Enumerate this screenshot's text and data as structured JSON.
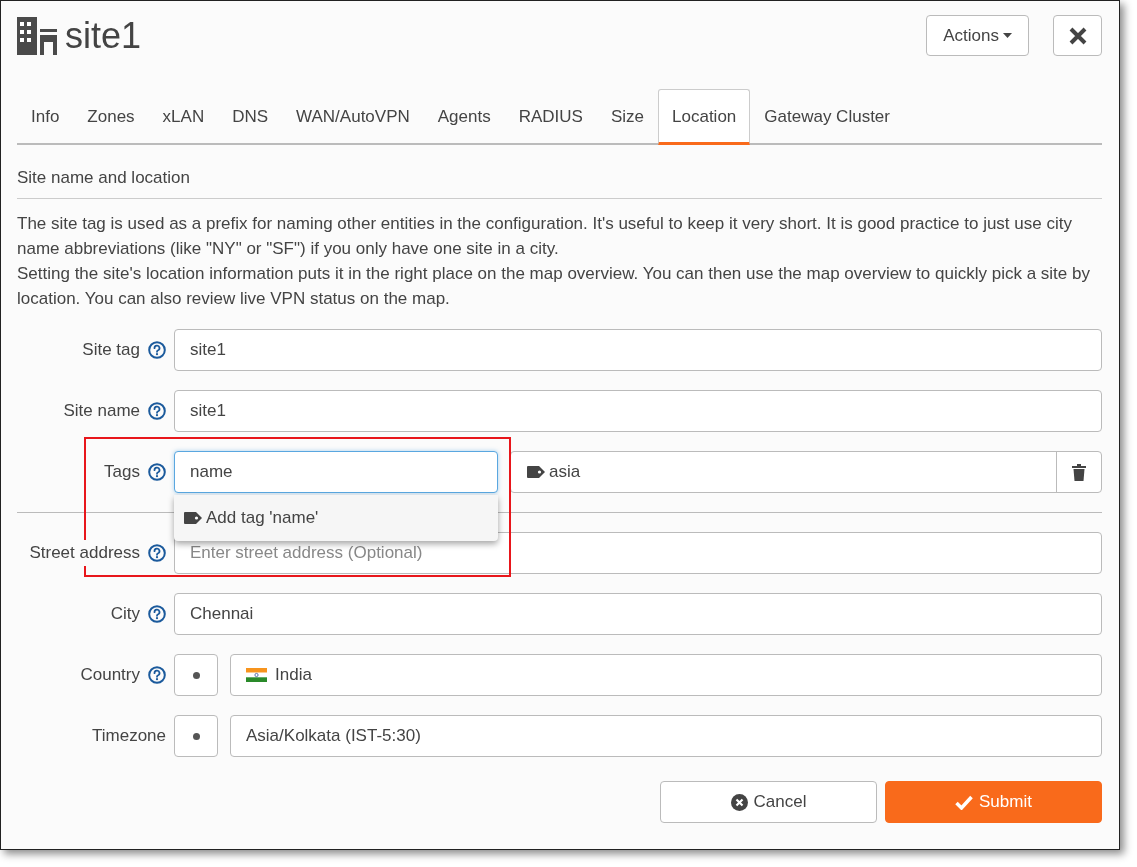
{
  "header": {
    "title": "site1",
    "actions": "Actions"
  },
  "tabs": [
    {
      "label": "Info",
      "selected": false
    },
    {
      "label": "Zones",
      "selected": false
    },
    {
      "label": "xLAN",
      "selected": false
    },
    {
      "label": "DNS",
      "selected": false
    },
    {
      "label": "WAN/AutoVPN",
      "selected": false
    },
    {
      "label": "Agents",
      "selected": false
    },
    {
      "label": "RADIUS",
      "selected": false
    },
    {
      "label": "Size",
      "selected": false
    },
    {
      "label": "Location",
      "selected": true
    },
    {
      "label": "Gateway Cluster",
      "selected": false
    }
  ],
  "section_title": "Site name and location",
  "description": [
    "The site tag is used as a prefix for naming other entities in the configuration. It's useful to keep it very short. It is good practice to just use city name abbreviations (like \"NY\" or \"SF\") if you only have one site in a city.",
    "Setting the site's location information puts it in the right place on the map overview. You can then use the map overview to quickly pick a site by location. You can also review live VPN status on the map."
  ],
  "fields": [
    {
      "kind": "text",
      "label": "Site tag",
      "help": true,
      "value": "site1"
    },
    {
      "kind": "text",
      "label": "Site name",
      "help": true,
      "value": "site1"
    },
    {
      "kind": "tags",
      "label": "Tags",
      "help": true,
      "value": "name",
      "focused": true,
      "suggestion": "Add tag 'name'",
      "tags": [
        "asia"
      ]
    },
    {
      "kind": "text",
      "label": "Street address",
      "help": true,
      "placeholder": "Enter street address (Optional)"
    },
    {
      "kind": "text",
      "label": "City",
      "help": true,
      "value": "Chennai"
    },
    {
      "kind": "country",
      "label": "Country",
      "help": true,
      "value": "India"
    },
    {
      "kind": "select",
      "label": "Timezone",
      "help": false,
      "value": "Asia/Kolkata (IST-5:30)"
    }
  ],
  "buttons": [
    {
      "kind": "cancel",
      "label": "Cancel"
    },
    {
      "kind": "submit",
      "label": "Submit"
    }
  ]
}
